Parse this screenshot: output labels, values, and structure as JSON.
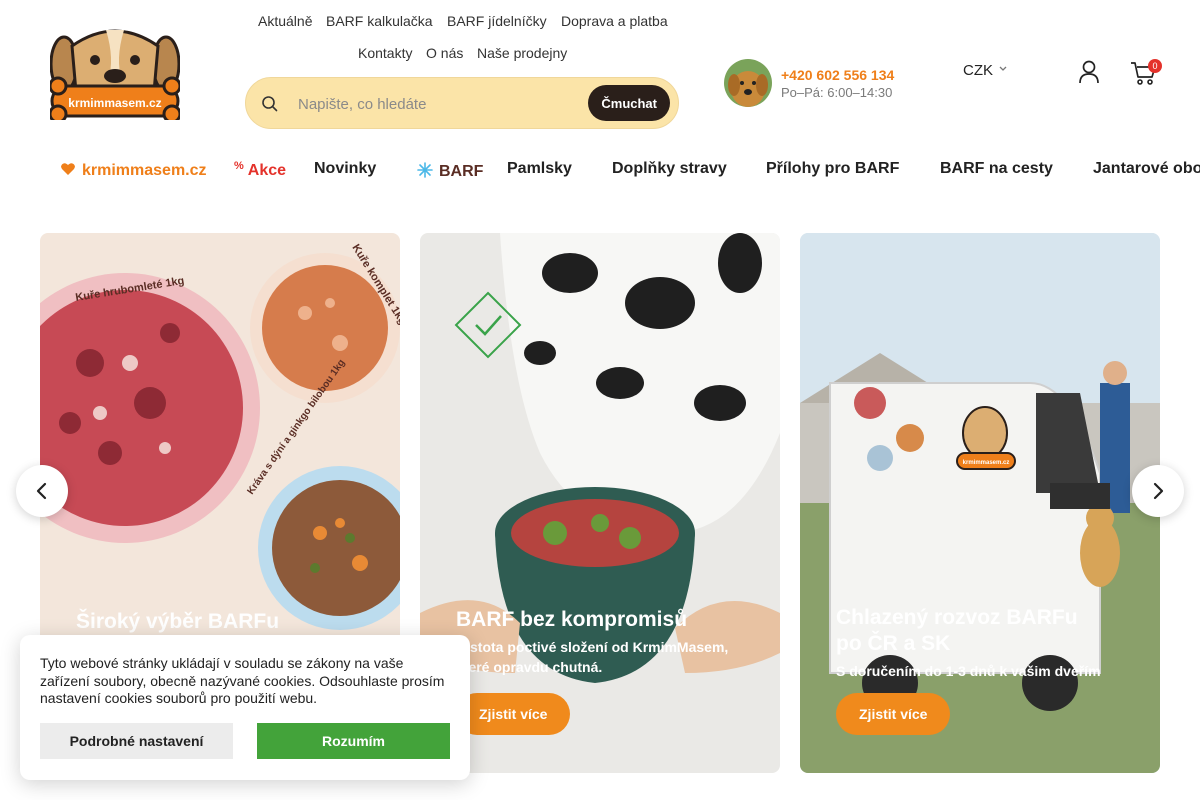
{
  "logo": {
    "text": "krmimmasem.cz"
  },
  "top_links": [
    "Aktuálně",
    "BARF kalkulačka",
    "BARF jídelníčky",
    "Doprava a platba",
    "Kontakty",
    "O nás",
    "Naše prodejny"
  ],
  "search": {
    "placeholder": "Napište, co hledáte",
    "button": "Čmuchat"
  },
  "contact": {
    "phone": "+420 602 556 134",
    "hours": "Po–Pá: 6:00–14:30"
  },
  "currency": "CZK",
  "cart": {
    "count": "0"
  },
  "nav": {
    "items": [
      {
        "label": "krmimmasem.cz",
        "icon": "heart-icon"
      },
      {
        "label": "Akce",
        "icon": "percent-icon"
      },
      {
        "label": "Novinky"
      },
      {
        "label": "BARF",
        "icon": "snowflake-icon"
      },
      {
        "label": "Pamlsky"
      },
      {
        "label": "Doplňky stravy"
      },
      {
        "label": "Přílohy pro BARF"
      },
      {
        "label": "BARF na cesty"
      },
      {
        "label": "Jantarové obo"
      }
    ]
  },
  "banners": [
    {
      "labels": [
        "Kuře hrubomleté 1kg",
        "Kuře komplet 1kg",
        "Kráva s dýní a ginkgo bilobou 1kg"
      ],
      "title": "Široký výběr BARFu",
      "subtitle": "",
      "button": ""
    },
    {
      "title": "BARF bez kompromisů",
      "subtitle": "Čistota poctivé složení od KrmimMasem, které opravdu chutná.",
      "button": "Zjistit více"
    },
    {
      "title_line1": "Chlazený rozvoz BARFu",
      "title_line2": "po ČR a SK",
      "subtitle": "S doručením do 1-3 dnů k vašim dveřím",
      "button": "Zjistit více",
      "van_logo": "krmimmasem.cz"
    }
  ],
  "cookie": {
    "text": "Tyto webové stránky ukládají v souladu se zákony na vaše zařízení soubory, obecně nazývané cookies. Odsouhlaste prosím nastavení cookies souborů pro použití webu.",
    "settings": "Podrobné nastavení",
    "accept": "Rozumím"
  },
  "colors": {
    "accent": "#ef7f1a",
    "search_bg": "#fbe4a8",
    "accept": "#43a33a",
    "badge": "#e4322b"
  }
}
